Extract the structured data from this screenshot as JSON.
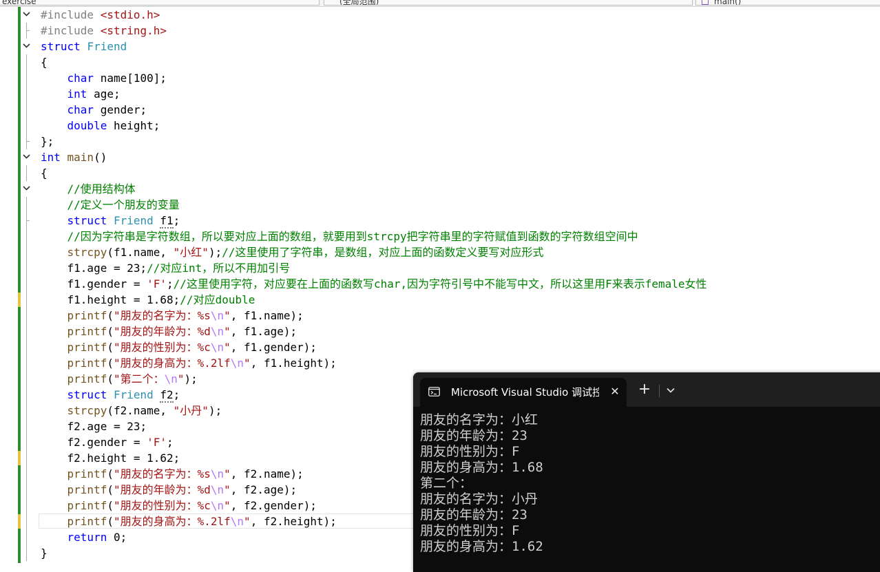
{
  "toolbar": {
    "project_dropdown": "exercise",
    "scope_dropdown": "(全局范围)",
    "member_dropdown": "main()"
  },
  "console": {
    "tab_title": "Microsoft Visual Studio 调试控制台",
    "output_lines": [
      "朋友的名字为：小红",
      "朋友的年龄为：23",
      "朋友的性别为：F",
      "朋友的身高为：1.68",
      "第二个：",
      "朋友的名字为：小丹",
      "朋友的年龄为：23",
      "朋友的性别为：F",
      "朋友的身高为：1.62"
    ]
  },
  "code": {
    "lines": [
      {
        "fold": "open",
        "guide": "none",
        "tokens": [
          [
            "pp",
            "#include "
          ],
          [
            "inc",
            "<stdio.h>"
          ]
        ]
      },
      {
        "fold": "none",
        "guide": "end",
        "tokens": [
          [
            "pp",
            "#include "
          ],
          [
            "inc",
            "<string.h>"
          ]
        ]
      },
      {
        "fold": "open",
        "guide": "none",
        "tokens": [
          [
            "kw",
            "struct "
          ],
          [
            "ty",
            "Friend"
          ]
        ]
      },
      {
        "fold": "none",
        "guide": "mid",
        "tokens": [
          [
            "id",
            "{"
          ]
        ]
      },
      {
        "fold": "none",
        "guide": "mid",
        "tokens": [
          [
            "id",
            "    "
          ],
          [
            "kw",
            "char "
          ],
          [
            "id",
            "name[100];"
          ]
        ]
      },
      {
        "fold": "none",
        "guide": "mid",
        "tokens": [
          [
            "id",
            "    "
          ],
          [
            "kw",
            "int "
          ],
          [
            "id",
            "age;"
          ]
        ]
      },
      {
        "fold": "none",
        "guide": "mid",
        "tokens": [
          [
            "id",
            "    "
          ],
          [
            "kw",
            "char "
          ],
          [
            "id",
            "gender;"
          ]
        ]
      },
      {
        "fold": "none",
        "guide": "mid",
        "tokens": [
          [
            "id",
            "    "
          ],
          [
            "kw",
            "double "
          ],
          [
            "id",
            "height;"
          ]
        ]
      },
      {
        "fold": "none",
        "guide": "end",
        "tokens": [
          [
            "id",
            "};"
          ]
        ]
      },
      {
        "fold": "open",
        "guide": "none",
        "tokens": [
          [
            "kw",
            "int "
          ],
          [
            "fn",
            "main"
          ],
          [
            "id",
            "()"
          ]
        ]
      },
      {
        "fold": "none",
        "guide": "mid",
        "tokens": [
          [
            "id",
            "{"
          ]
        ]
      },
      {
        "fold": "open",
        "guide": "none",
        "tokens": [
          [
            "id",
            "    "
          ],
          [
            "cm",
            "//使用结构体"
          ]
        ]
      },
      {
        "fold": "none",
        "guide": "mid",
        "tokens": [
          [
            "id",
            "    "
          ],
          [
            "cm",
            "//定义一个朋友的变量"
          ]
        ]
      },
      {
        "fold": "none",
        "guide": "end",
        "tokens": [
          [
            "id",
            "    "
          ],
          [
            "kw",
            "struct "
          ],
          [
            "ty",
            "Friend "
          ],
          [
            "sq",
            "f1"
          ],
          [
            "id",
            ";"
          ]
        ]
      },
      {
        "fold": "none",
        "guide": "mid",
        "tokens": [
          [
            "id",
            "    "
          ],
          [
            "cm",
            "//因为字符串是字符数组，所以要对应上面的数组，就要用到strcpy把字符串里的字符赋值到函数的字符数组空间中"
          ]
        ]
      },
      {
        "fold": "none",
        "guide": "mid",
        "tokens": [
          [
            "id",
            "    "
          ],
          [
            "fn",
            "strcpy"
          ],
          [
            "id",
            "(f1.name, "
          ],
          [
            "str",
            "\"小红\""
          ],
          [
            "id",
            ");"
          ],
          [
            "cm",
            "//这里使用了字符串，是数组，对应上面的函数定义要写对应形式"
          ]
        ]
      },
      {
        "fold": "none",
        "guide": "mid",
        "tokens": [
          [
            "id",
            "    f1.age = 23;"
          ],
          [
            "cm",
            "//对应int，所以不用加引号"
          ]
        ]
      },
      {
        "fold": "none",
        "guide": "mid",
        "tokens": [
          [
            "id",
            "    f1.gender = "
          ],
          [
            "str",
            "'F'"
          ],
          [
            "id",
            ";"
          ],
          [
            "cm",
            "//这里使用字符，对应要在上面的函数写char,因为字符引号中不能写中文，所以这里用F来表示female女性"
          ]
        ]
      },
      {
        "fold": "none",
        "guide": "mid",
        "tokens": [
          [
            "id",
            "    f1.height = 1.68;"
          ],
          [
            "cm",
            "//对应double"
          ]
        ]
      },
      {
        "fold": "none",
        "guide": "mid",
        "tokens": [
          [
            "id",
            "    "
          ],
          [
            "fn",
            "printf"
          ],
          [
            "id",
            "("
          ],
          [
            "str",
            "\"朋友的名字为：%s"
          ],
          [
            "esc",
            "\\n"
          ],
          [
            "str",
            "\""
          ],
          [
            "id",
            ", f1.name);"
          ]
        ]
      },
      {
        "fold": "none",
        "guide": "mid",
        "tokens": [
          [
            "id",
            "    "
          ],
          [
            "fn",
            "printf"
          ],
          [
            "id",
            "("
          ],
          [
            "str",
            "\"朋友的年龄为：%d"
          ],
          [
            "esc",
            "\\n"
          ],
          [
            "str",
            "\""
          ],
          [
            "id",
            ", f1.age);"
          ]
        ]
      },
      {
        "fold": "none",
        "guide": "mid",
        "tokens": [
          [
            "id",
            "    "
          ],
          [
            "fn",
            "printf"
          ],
          [
            "id",
            "("
          ],
          [
            "str",
            "\"朋友的性别为：%c"
          ],
          [
            "esc",
            "\\n"
          ],
          [
            "str",
            "\""
          ],
          [
            "id",
            ", f1.gender);"
          ]
        ]
      },
      {
        "fold": "none",
        "guide": "mid",
        "tokens": [
          [
            "id",
            "    "
          ],
          [
            "fn",
            "printf"
          ],
          [
            "id",
            "("
          ],
          [
            "str",
            "\"朋友的身高为：%.2lf"
          ],
          [
            "esc",
            "\\n"
          ],
          [
            "str",
            "\""
          ],
          [
            "id",
            ", f1.height);"
          ]
        ]
      },
      {
        "fold": "none",
        "guide": "mid",
        "tokens": [
          [
            "id",
            "    "
          ],
          [
            "fn",
            "printf"
          ],
          [
            "id",
            "("
          ],
          [
            "str",
            "\"第二个："
          ],
          [
            "esc",
            "\\n"
          ],
          [
            "str",
            "\""
          ],
          [
            "id",
            ");"
          ]
        ]
      },
      {
        "fold": "none",
        "guide": "mid",
        "tokens": [
          [
            "id",
            "    "
          ],
          [
            "kw",
            "struct "
          ],
          [
            "ty",
            "Friend "
          ],
          [
            "sq",
            "f2"
          ],
          [
            "id",
            ";"
          ]
        ]
      },
      {
        "fold": "none",
        "guide": "mid",
        "tokens": [
          [
            "id",
            "    "
          ],
          [
            "fn",
            "strcpy"
          ],
          [
            "id",
            "(f2.name, "
          ],
          [
            "str",
            "\"小丹\""
          ],
          [
            "id",
            ");"
          ]
        ]
      },
      {
        "fold": "none",
        "guide": "mid",
        "tokens": [
          [
            "id",
            "    f2.age = 23;"
          ]
        ]
      },
      {
        "fold": "none",
        "guide": "mid",
        "tokens": [
          [
            "id",
            "    f2.gender = "
          ],
          [
            "str",
            "'F'"
          ],
          [
            "id",
            ";"
          ]
        ]
      },
      {
        "fold": "none",
        "guide": "mid",
        "tokens": [
          [
            "id",
            "    f2.height = 1.62;"
          ]
        ]
      },
      {
        "fold": "none",
        "guide": "mid",
        "tokens": [
          [
            "id",
            "    "
          ],
          [
            "fn",
            "printf"
          ],
          [
            "id",
            "("
          ],
          [
            "str",
            "\"朋友的名字为：%s"
          ],
          [
            "esc",
            "\\n"
          ],
          [
            "str",
            "\""
          ],
          [
            "id",
            ", f2.name);"
          ]
        ]
      },
      {
        "fold": "none",
        "guide": "mid",
        "tokens": [
          [
            "id",
            "    "
          ],
          [
            "fn",
            "printf"
          ],
          [
            "id",
            "("
          ],
          [
            "str",
            "\"朋友的年龄为：%d"
          ],
          [
            "esc",
            "\\n"
          ],
          [
            "str",
            "\""
          ],
          [
            "id",
            ", f2.age);"
          ]
        ]
      },
      {
        "fold": "none",
        "guide": "mid",
        "tokens": [
          [
            "id",
            "    "
          ],
          [
            "fn",
            "printf"
          ],
          [
            "id",
            "("
          ],
          [
            "str",
            "\"朋友的性别为：%c"
          ],
          [
            "esc",
            "\\n"
          ],
          [
            "str",
            "\""
          ],
          [
            "id",
            ", f2.gender);"
          ]
        ]
      },
      {
        "fold": "none",
        "guide": "mid",
        "current": true,
        "tokens": [
          [
            "id",
            "    "
          ],
          [
            "fn",
            "printf"
          ],
          [
            "id",
            "("
          ],
          [
            "str",
            "\"朋友的身高为：%.2lf"
          ],
          [
            "esc",
            "\\n"
          ],
          [
            "str",
            "\""
          ],
          [
            "id",
            ", f2.height);"
          ]
        ]
      },
      {
        "fold": "none",
        "guide": "mid",
        "tokens": [
          [
            "id",
            "    "
          ],
          [
            "kw",
            "return "
          ],
          [
            "id",
            "0;"
          ]
        ]
      },
      {
        "fold": "none",
        "guide": "mid",
        "tokens": [
          [
            "id",
            "}"
          ]
        ]
      }
    ]
  },
  "change_markers": [
    18,
    28,
    32
  ]
}
